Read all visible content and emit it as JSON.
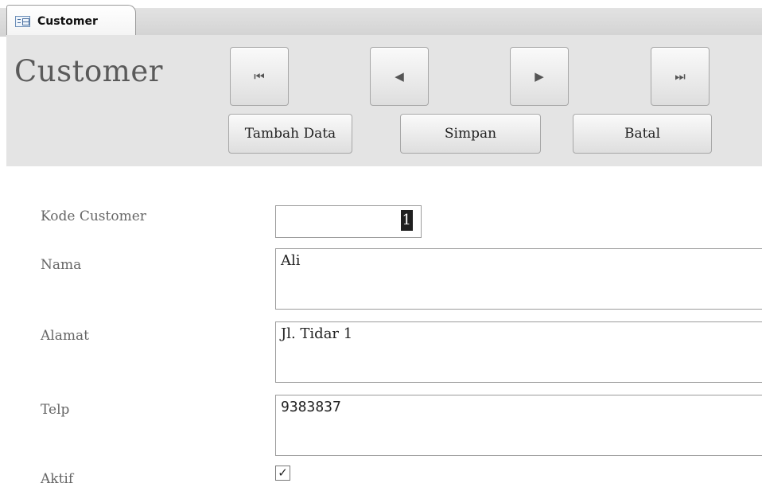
{
  "tab": {
    "label": "Customer",
    "icon": "form-icon"
  },
  "header": {
    "title": "Customer",
    "nav": [
      {
        "name": "first-record-button",
        "icon": "first-record-icon",
        "glyph": "⏮"
      },
      {
        "name": "previous-record-button",
        "icon": "previous-record-icon",
        "glyph": "◀"
      },
      {
        "name": "next-record-button",
        "icon": "next-record-icon",
        "glyph": "▶"
      },
      {
        "name": "last-record-button",
        "icon": "last-record-icon",
        "glyph": "⏭"
      }
    ],
    "buttons": {
      "add": "Tambah Data",
      "save": "Simpan",
      "cancel": "Batal"
    }
  },
  "form": {
    "kode_label": "Kode Customer",
    "kode_value": "1",
    "nama_label": "Nama",
    "nama_value": "Ali",
    "alamat_label": "Alamat",
    "alamat_value": "Jl. Tidar 1",
    "telp_label": "Telp",
    "telp_value": "9383837",
    "aktif_label": "Aktif",
    "aktif_checked": true,
    "check_glyph": "✓"
  },
  "colors": {
    "header_bg": "#e4e4e4",
    "title_color": "#5a5a5a",
    "label_color": "#666666"
  }
}
